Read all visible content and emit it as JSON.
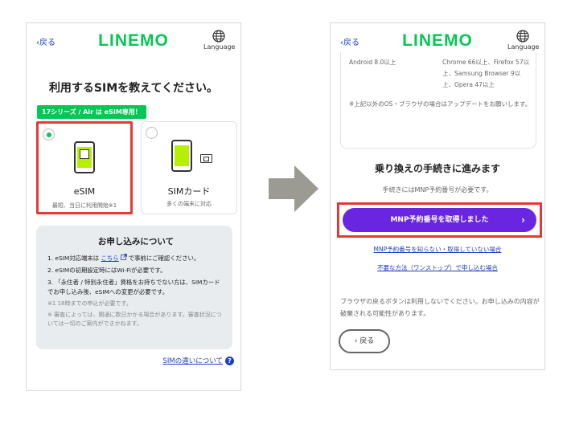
{
  "left_screen": {
    "header": {
      "back_label": "‹戻る",
      "logo": "LINEMO",
      "language_label": "Language"
    },
    "title": "利用するSIMを教えてください。",
    "badge": "17シリーズ / Air は eSIM専用！",
    "options": [
      {
        "label": "eSIM",
        "sub": "最短、当日に利用開始※1",
        "selected": true
      },
      {
        "label": "SIMカード",
        "sub": "多くの端末に対応",
        "selected": false
      }
    ],
    "info": {
      "title": "お申し込みについて",
      "item1_pre": "1.  eSIM対応端末は",
      "item1_link": "こちら",
      "item1_post": "で事前にご確認ください。",
      "item2": "2.  eSIMの初期設定時にはWi-Fiが必要です。",
      "item3": "3.  「永住者 / 特別永住者」資格をお持ちでない方は、SIMカードでお申し込み後、eSIMへの変更が必要です。",
      "note1": "※1 18時までの申込が必要です。",
      "note2": "※ 審査によっては、開通に数日かかる場合があります。審査状況については一切のご案内ができかねます。"
    },
    "diff_link": "SIMの違いについて"
  },
  "right_screen": {
    "header": {
      "back_label": "‹戻る",
      "logo": "LINEMO",
      "language_label": "Language"
    },
    "compat": {
      "os": "Android 8.0以上",
      "browsers": "Chrome 66以上、Firefox 57以上、Samsung Browser 9以上、Opera 47以上",
      "note": "※上記以外のOS・ブラウザの場合はアップデートをお願いします。"
    },
    "title": "乗り換えの手続きに進みます",
    "subtitle": "手続きにはMNP予約番号が必要です。",
    "mnp_button": "MNP予約番号を取得しました",
    "link1": "MNP予約番号を知らない・取得していない場合",
    "link2": "不要な方法（ワンストップ）で申し込む場合",
    "warning": "ブラウザの戻るボタンは利用しないでください。お申し込みの内容が破棄される可能性があります。",
    "back_button": "戻る"
  },
  "colors": {
    "brand": "#06c755",
    "accent": "#6a25e0",
    "highlight": "#e53935",
    "link": "#1e3fbf"
  }
}
